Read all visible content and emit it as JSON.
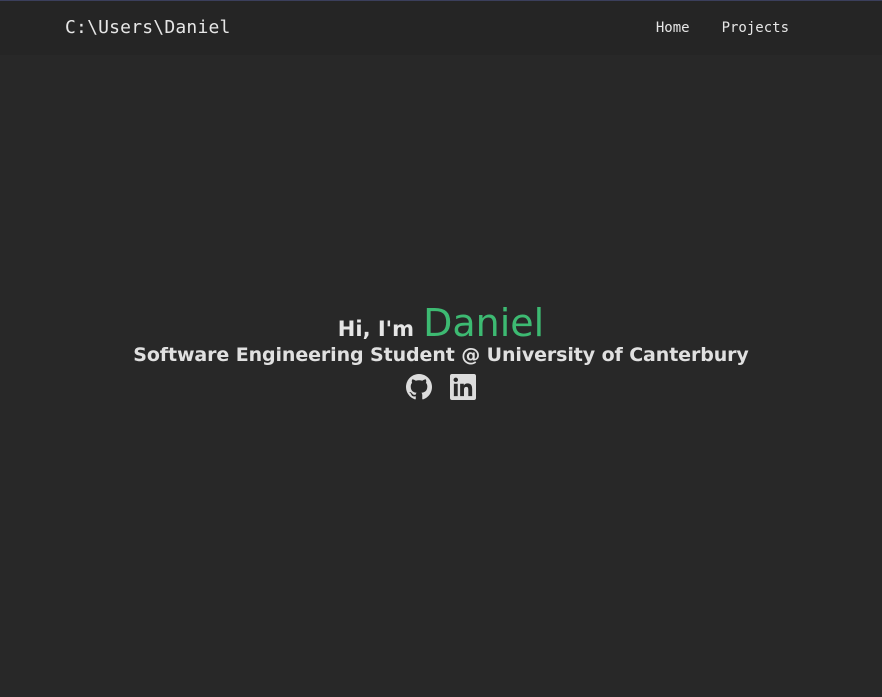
{
  "nav": {
    "brand": "C:\\Users\\Daniel",
    "links": [
      {
        "label": "Home"
      },
      {
        "label": "Projects"
      }
    ]
  },
  "hero": {
    "greeting_prefix": "Hi, I'm",
    "name": "Daniel",
    "subtitle": "Software Engineering Student @ University of Canterbury"
  },
  "social": [
    {
      "icon": "github-icon"
    },
    {
      "icon": "linkedin-icon"
    }
  ],
  "colors": {
    "background": "#282828",
    "navbar": "#252525",
    "accent": "#3dba72",
    "text": "#e6e6e6"
  }
}
